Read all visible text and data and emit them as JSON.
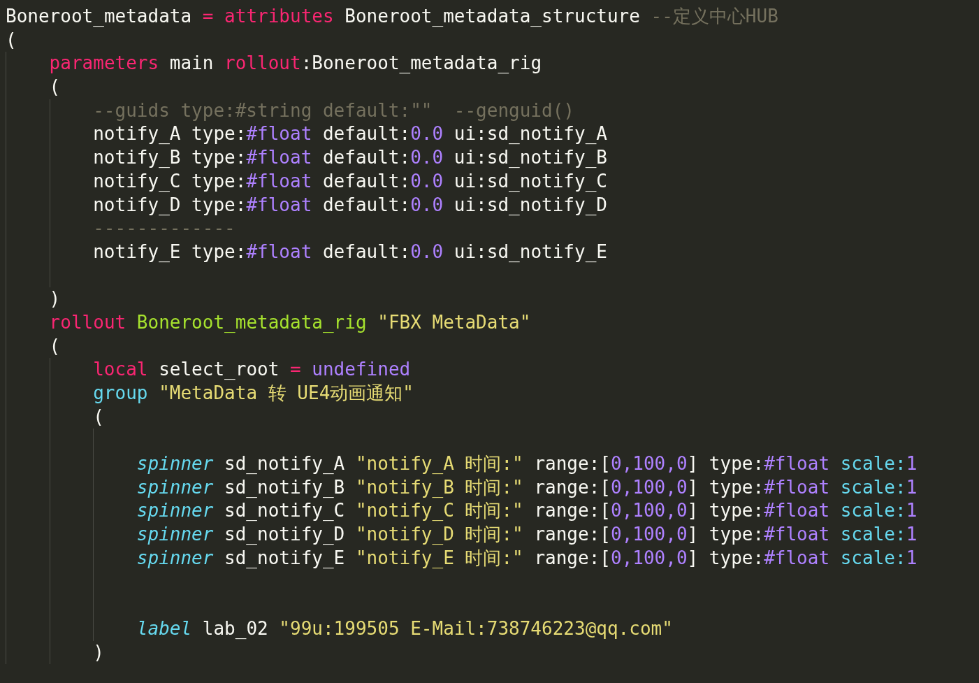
{
  "editor": {
    "lines": [
      {
        "kind": "code",
        "tokens": [
          {
            "kind": "plain",
            "text": "Boneroot_metadata "
          },
          {
            "kind": "keyword",
            "text": "="
          },
          {
            "kind": "keyword",
            "text": " attributes"
          },
          {
            "kind": "plain",
            "text": " Boneroot_metadata_structure "
          },
          {
            "kind": "comment",
            "text": "--定义中心HUB"
          }
        ]
      },
      {
        "kind": "code",
        "tokens": [
          {
            "kind": "plain",
            "text": "("
          }
        ],
        "children": [
          {
            "kind": "code",
            "tokens": [
              {
                "kind": "keyword",
                "text": "parameters"
              },
              {
                "kind": "plain",
                "text": " main "
              },
              {
                "kind": "keyword",
                "text": "rollout"
              },
              {
                "kind": "plain",
                "text": ":Boneroot_metadata_rig"
              }
            ]
          },
          {
            "kind": "code",
            "tokens": [
              {
                "kind": "plain",
                "text": "("
              }
            ],
            "children": [
              {
                "kind": "code",
                "tokens": [
                  {
                    "kind": "comment",
                    "text": "--guids type:#string default:\"\"  --genguid()"
                  }
                ]
              },
              {
                "kind": "code",
                "tokens": [
                  {
                    "kind": "plain",
                    "text": "notify_A type:"
                  },
                  {
                    "kind": "number",
                    "text": "#float"
                  },
                  {
                    "kind": "plain",
                    "text": " default:"
                  },
                  {
                    "kind": "number",
                    "text": "0.0"
                  },
                  {
                    "kind": "plain",
                    "text": " ui:sd_notify_A"
                  }
                ]
              },
              {
                "kind": "code",
                "tokens": [
                  {
                    "kind": "plain",
                    "text": "notify_B type:"
                  },
                  {
                    "kind": "number",
                    "text": "#float"
                  },
                  {
                    "kind": "plain",
                    "text": " default:"
                  },
                  {
                    "kind": "number",
                    "text": "0.0"
                  },
                  {
                    "kind": "plain",
                    "text": " ui:sd_notify_B"
                  }
                ]
              },
              {
                "kind": "code",
                "tokens": [
                  {
                    "kind": "plain",
                    "text": "notify_C type:"
                  },
                  {
                    "kind": "number",
                    "text": "#float"
                  },
                  {
                    "kind": "plain",
                    "text": " default:"
                  },
                  {
                    "kind": "number",
                    "text": "0.0"
                  },
                  {
                    "kind": "plain",
                    "text": " ui:sd_notify_C"
                  }
                ]
              },
              {
                "kind": "code",
                "tokens": [
                  {
                    "kind": "plain",
                    "text": "notify_D type:"
                  },
                  {
                    "kind": "number",
                    "text": "#float"
                  },
                  {
                    "kind": "plain",
                    "text": " default:"
                  },
                  {
                    "kind": "number",
                    "text": "0.0"
                  },
                  {
                    "kind": "plain",
                    "text": " ui:sd_notify_D"
                  }
                ]
              },
              {
                "kind": "code",
                "tokens": [
                  {
                    "kind": "comment",
                    "text": "-------------"
                  }
                ]
              },
              {
                "kind": "code",
                "tokens": [
                  {
                    "kind": "plain",
                    "text": "notify_E type:"
                  },
                  {
                    "kind": "number",
                    "text": "#float"
                  },
                  {
                    "kind": "plain",
                    "text": " default:"
                  },
                  {
                    "kind": "number",
                    "text": "0.0"
                  },
                  {
                    "kind": "plain",
                    "text": " ui:sd_notify_E"
                  }
                ]
              },
              {
                "kind": "blank"
              }
            ]
          },
          {
            "kind": "code",
            "tokens": [
              {
                "kind": "plain",
                "text": ")"
              }
            ]
          },
          {
            "kind": "code",
            "tokens": [
              {
                "kind": "keyword",
                "text": "rollout "
              },
              {
                "kind": "function",
                "text": "Boneroot_metadata_rig"
              },
              {
                "kind": "string",
                "text": " \"FBX MetaData\""
              }
            ]
          },
          {
            "kind": "code",
            "tokens": [
              {
                "kind": "plain",
                "text": "("
              }
            ],
            "children": [
              {
                "kind": "code",
                "tokens": [
                  {
                    "kind": "keyword",
                    "text": "local"
                  },
                  {
                    "kind": "plain",
                    "text": " select_root "
                  },
                  {
                    "kind": "keyword",
                    "text": "="
                  },
                  {
                    "kind": "number",
                    "text": " undefined"
                  }
                ]
              },
              {
                "kind": "code",
                "tokens": [
                  {
                    "kind": "builtin",
                    "text": "group"
                  },
                  {
                    "kind": "string",
                    "text": " \"MetaData 转 UE4动画通知\""
                  }
                ]
              },
              {
                "kind": "code",
                "tokens": [
                  {
                    "kind": "plain",
                    "text": "("
                  }
                ],
                "children": [
                  {
                    "kind": "blank"
                  },
                  {
                    "kind": "code",
                    "tokens": [
                      {
                        "kind": "builtin-italic",
                        "text": "spinner"
                      },
                      {
                        "kind": "plain",
                        "text": " sd_notify_A "
                      },
                      {
                        "kind": "string",
                        "text": "\"notify_A 时间:\""
                      },
                      {
                        "kind": "plain",
                        "text": " range:["
                      },
                      {
                        "kind": "number",
                        "text": "0,100,0"
                      },
                      {
                        "kind": "plain",
                        "text": "] type:"
                      },
                      {
                        "kind": "number",
                        "text": "#float"
                      },
                      {
                        "kind": "builtin",
                        "text": " scale:"
                      },
                      {
                        "kind": "number",
                        "text": "1"
                      }
                    ]
                  },
                  {
                    "kind": "code",
                    "tokens": [
                      {
                        "kind": "builtin-italic",
                        "text": "spinner"
                      },
                      {
                        "kind": "plain",
                        "text": " sd_notify_B "
                      },
                      {
                        "kind": "string",
                        "text": "\"notify_B 时间:\""
                      },
                      {
                        "kind": "plain",
                        "text": " range:["
                      },
                      {
                        "kind": "number",
                        "text": "0,100,0"
                      },
                      {
                        "kind": "plain",
                        "text": "] type:"
                      },
                      {
                        "kind": "number",
                        "text": "#float"
                      },
                      {
                        "kind": "builtin",
                        "text": " scale:"
                      },
                      {
                        "kind": "number",
                        "text": "1"
                      }
                    ]
                  },
                  {
                    "kind": "code",
                    "tokens": [
                      {
                        "kind": "builtin-italic",
                        "text": "spinner"
                      },
                      {
                        "kind": "plain",
                        "text": " sd_notify_C "
                      },
                      {
                        "kind": "string",
                        "text": "\"notify_C 时间:\""
                      },
                      {
                        "kind": "plain",
                        "text": " range:["
                      },
                      {
                        "kind": "number",
                        "text": "0,100,0"
                      },
                      {
                        "kind": "plain",
                        "text": "] type:"
                      },
                      {
                        "kind": "number",
                        "text": "#float"
                      },
                      {
                        "kind": "builtin",
                        "text": " scale:"
                      },
                      {
                        "kind": "number",
                        "text": "1"
                      }
                    ]
                  },
                  {
                    "kind": "code",
                    "tokens": [
                      {
                        "kind": "builtin-italic",
                        "text": "spinner"
                      },
                      {
                        "kind": "plain",
                        "text": " sd_notify_D "
                      },
                      {
                        "kind": "string",
                        "text": "\"notify_D 时间:\""
                      },
                      {
                        "kind": "plain",
                        "text": " range:["
                      },
                      {
                        "kind": "number",
                        "text": "0,100,0"
                      },
                      {
                        "kind": "plain",
                        "text": "] type:"
                      },
                      {
                        "kind": "number",
                        "text": "#float"
                      },
                      {
                        "kind": "builtin",
                        "text": " scale:"
                      },
                      {
                        "kind": "number",
                        "text": "1"
                      }
                    ]
                  },
                  {
                    "kind": "code",
                    "tokens": [
                      {
                        "kind": "builtin-italic",
                        "text": "spinner"
                      },
                      {
                        "kind": "plain",
                        "text": " sd_notify_E "
                      },
                      {
                        "kind": "string",
                        "text": "\"notify_E 时间:\""
                      },
                      {
                        "kind": "plain",
                        "text": " range:["
                      },
                      {
                        "kind": "number",
                        "text": "0,100,0"
                      },
                      {
                        "kind": "plain",
                        "text": "] type:"
                      },
                      {
                        "kind": "number",
                        "text": "#float"
                      },
                      {
                        "kind": "builtin",
                        "text": " scale:"
                      },
                      {
                        "kind": "number",
                        "text": "1"
                      }
                    ]
                  },
                  {
                    "kind": "blank"
                  },
                  {
                    "kind": "blank"
                  },
                  {
                    "kind": "code",
                    "tokens": [
                      {
                        "kind": "builtin-italic",
                        "text": "label"
                      },
                      {
                        "kind": "plain",
                        "text": " lab_02 "
                      },
                      {
                        "kind": "string",
                        "text": "\"99u:199505 E-Mail:738746223@qq.com\""
                      }
                    ]
                  }
                ]
              },
              {
                "kind": "code",
                "tokens": [
                  {
                    "kind": "plain",
                    "text": ")"
                  }
                ]
              }
            ]
          }
        ]
      }
    ]
  }
}
